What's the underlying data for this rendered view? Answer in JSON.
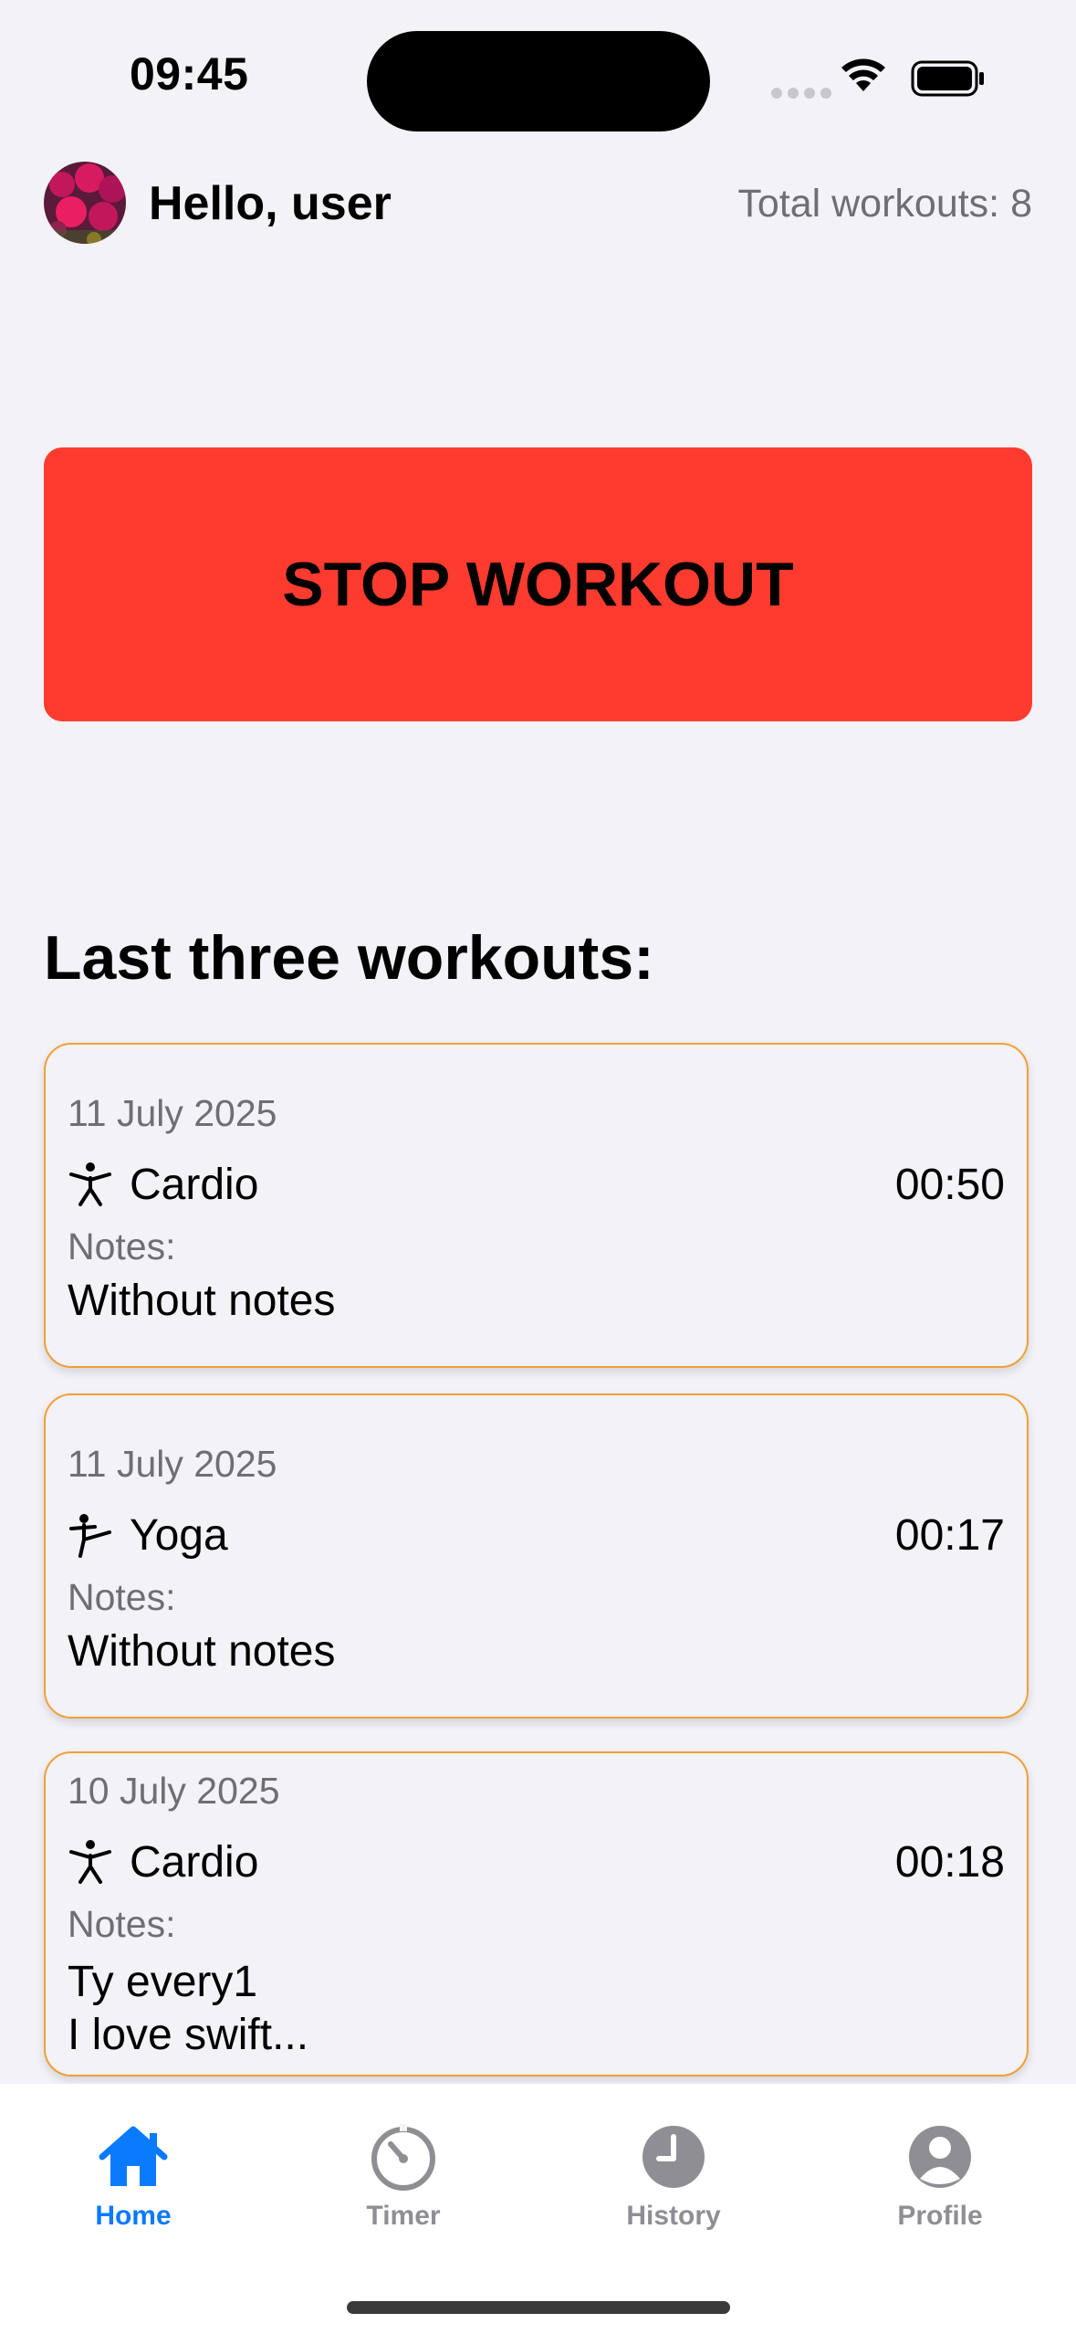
{
  "status_bar": {
    "time": "09:45"
  },
  "header": {
    "greeting": "Hello, user",
    "total_workouts": "Total workouts: 8"
  },
  "stop_button": {
    "label": "STOP WORKOUT",
    "color": "#ff3b30"
  },
  "section_title": "Last three workouts:",
  "workouts": [
    {
      "date": "11 July 2025",
      "type": "Cardio",
      "icon": "figure-cardio-icon",
      "duration": "00:50",
      "notes_label": "Notes:",
      "notes": "Without notes"
    },
    {
      "date": "11 July 2025",
      "type": "Yoga",
      "icon": "figure-kick-icon",
      "duration": "00:17",
      "notes_label": "Notes:",
      "notes": "Without notes"
    },
    {
      "date": "10 July 2025",
      "type": "Cardio",
      "icon": "figure-cardio-icon",
      "duration": "00:18",
      "notes_label": "Notes:",
      "notes": "Ty every1\nI love swift..."
    }
  ],
  "tabs": [
    {
      "label": "Home",
      "icon": "house-icon",
      "active": true
    },
    {
      "label": "Timer",
      "icon": "timer-icon",
      "active": false
    },
    {
      "label": "History",
      "icon": "clock-icon",
      "active": false
    },
    {
      "label": "Profile",
      "icon": "person-icon",
      "active": false
    }
  ],
  "colors": {
    "accent": "#0a7aff",
    "card_border": "#f29f38",
    "background": "#f2f2f7"
  }
}
